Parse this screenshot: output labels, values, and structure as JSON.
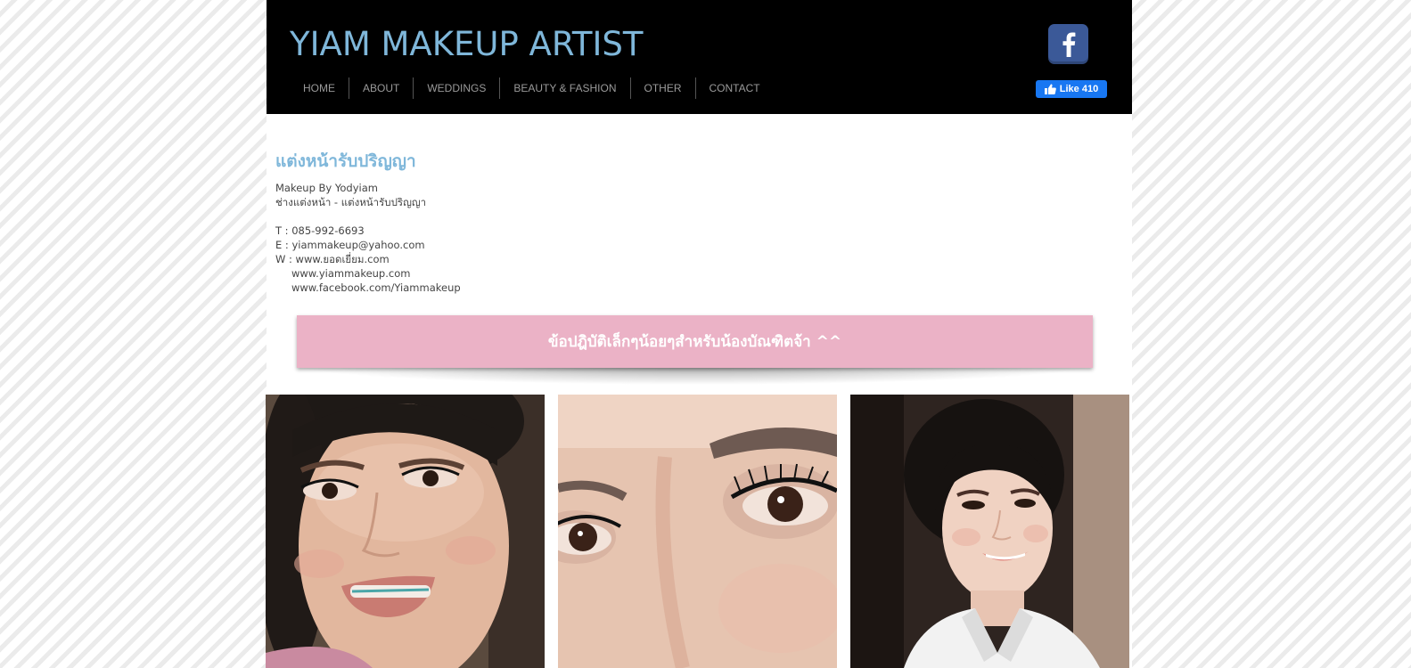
{
  "header": {
    "site_title": "YIAM MAKEUP ARTIST",
    "nav": [
      "HOME",
      "ABOUT",
      "WEDDINGS",
      "BEAUTY & FASHION",
      "OTHER",
      "CONTACT"
    ],
    "facebook_icon": "facebook-icon",
    "like_label": "Like 410"
  },
  "content": {
    "title": "แต่งหน้ารับปริญญา",
    "byline": "Makeup By Yodyiam",
    "subtitle": "ช่างแต่งหน้า - แต่งหน้ารับปริญญา",
    "phone": "T : 085-992-6693",
    "email": "E : yiammakeup@yahoo.com",
    "web1": "W : www.ยอดเยี่ยม.com",
    "web2": "www.yiammakeup.com",
    "web3": "www.facebook.com/Yiammakeup",
    "banner": "ข้อปฎิบัติเล็กๆน้อยๆสำหรับน้องบัณฑิตจ้า ^^"
  },
  "colors": {
    "header_bg": "#000000",
    "title_blue": "#7fb7da",
    "banner_pink": "#ebb2c6",
    "facebook_blue": "#3b5998",
    "like_blue": "#1877f2"
  }
}
